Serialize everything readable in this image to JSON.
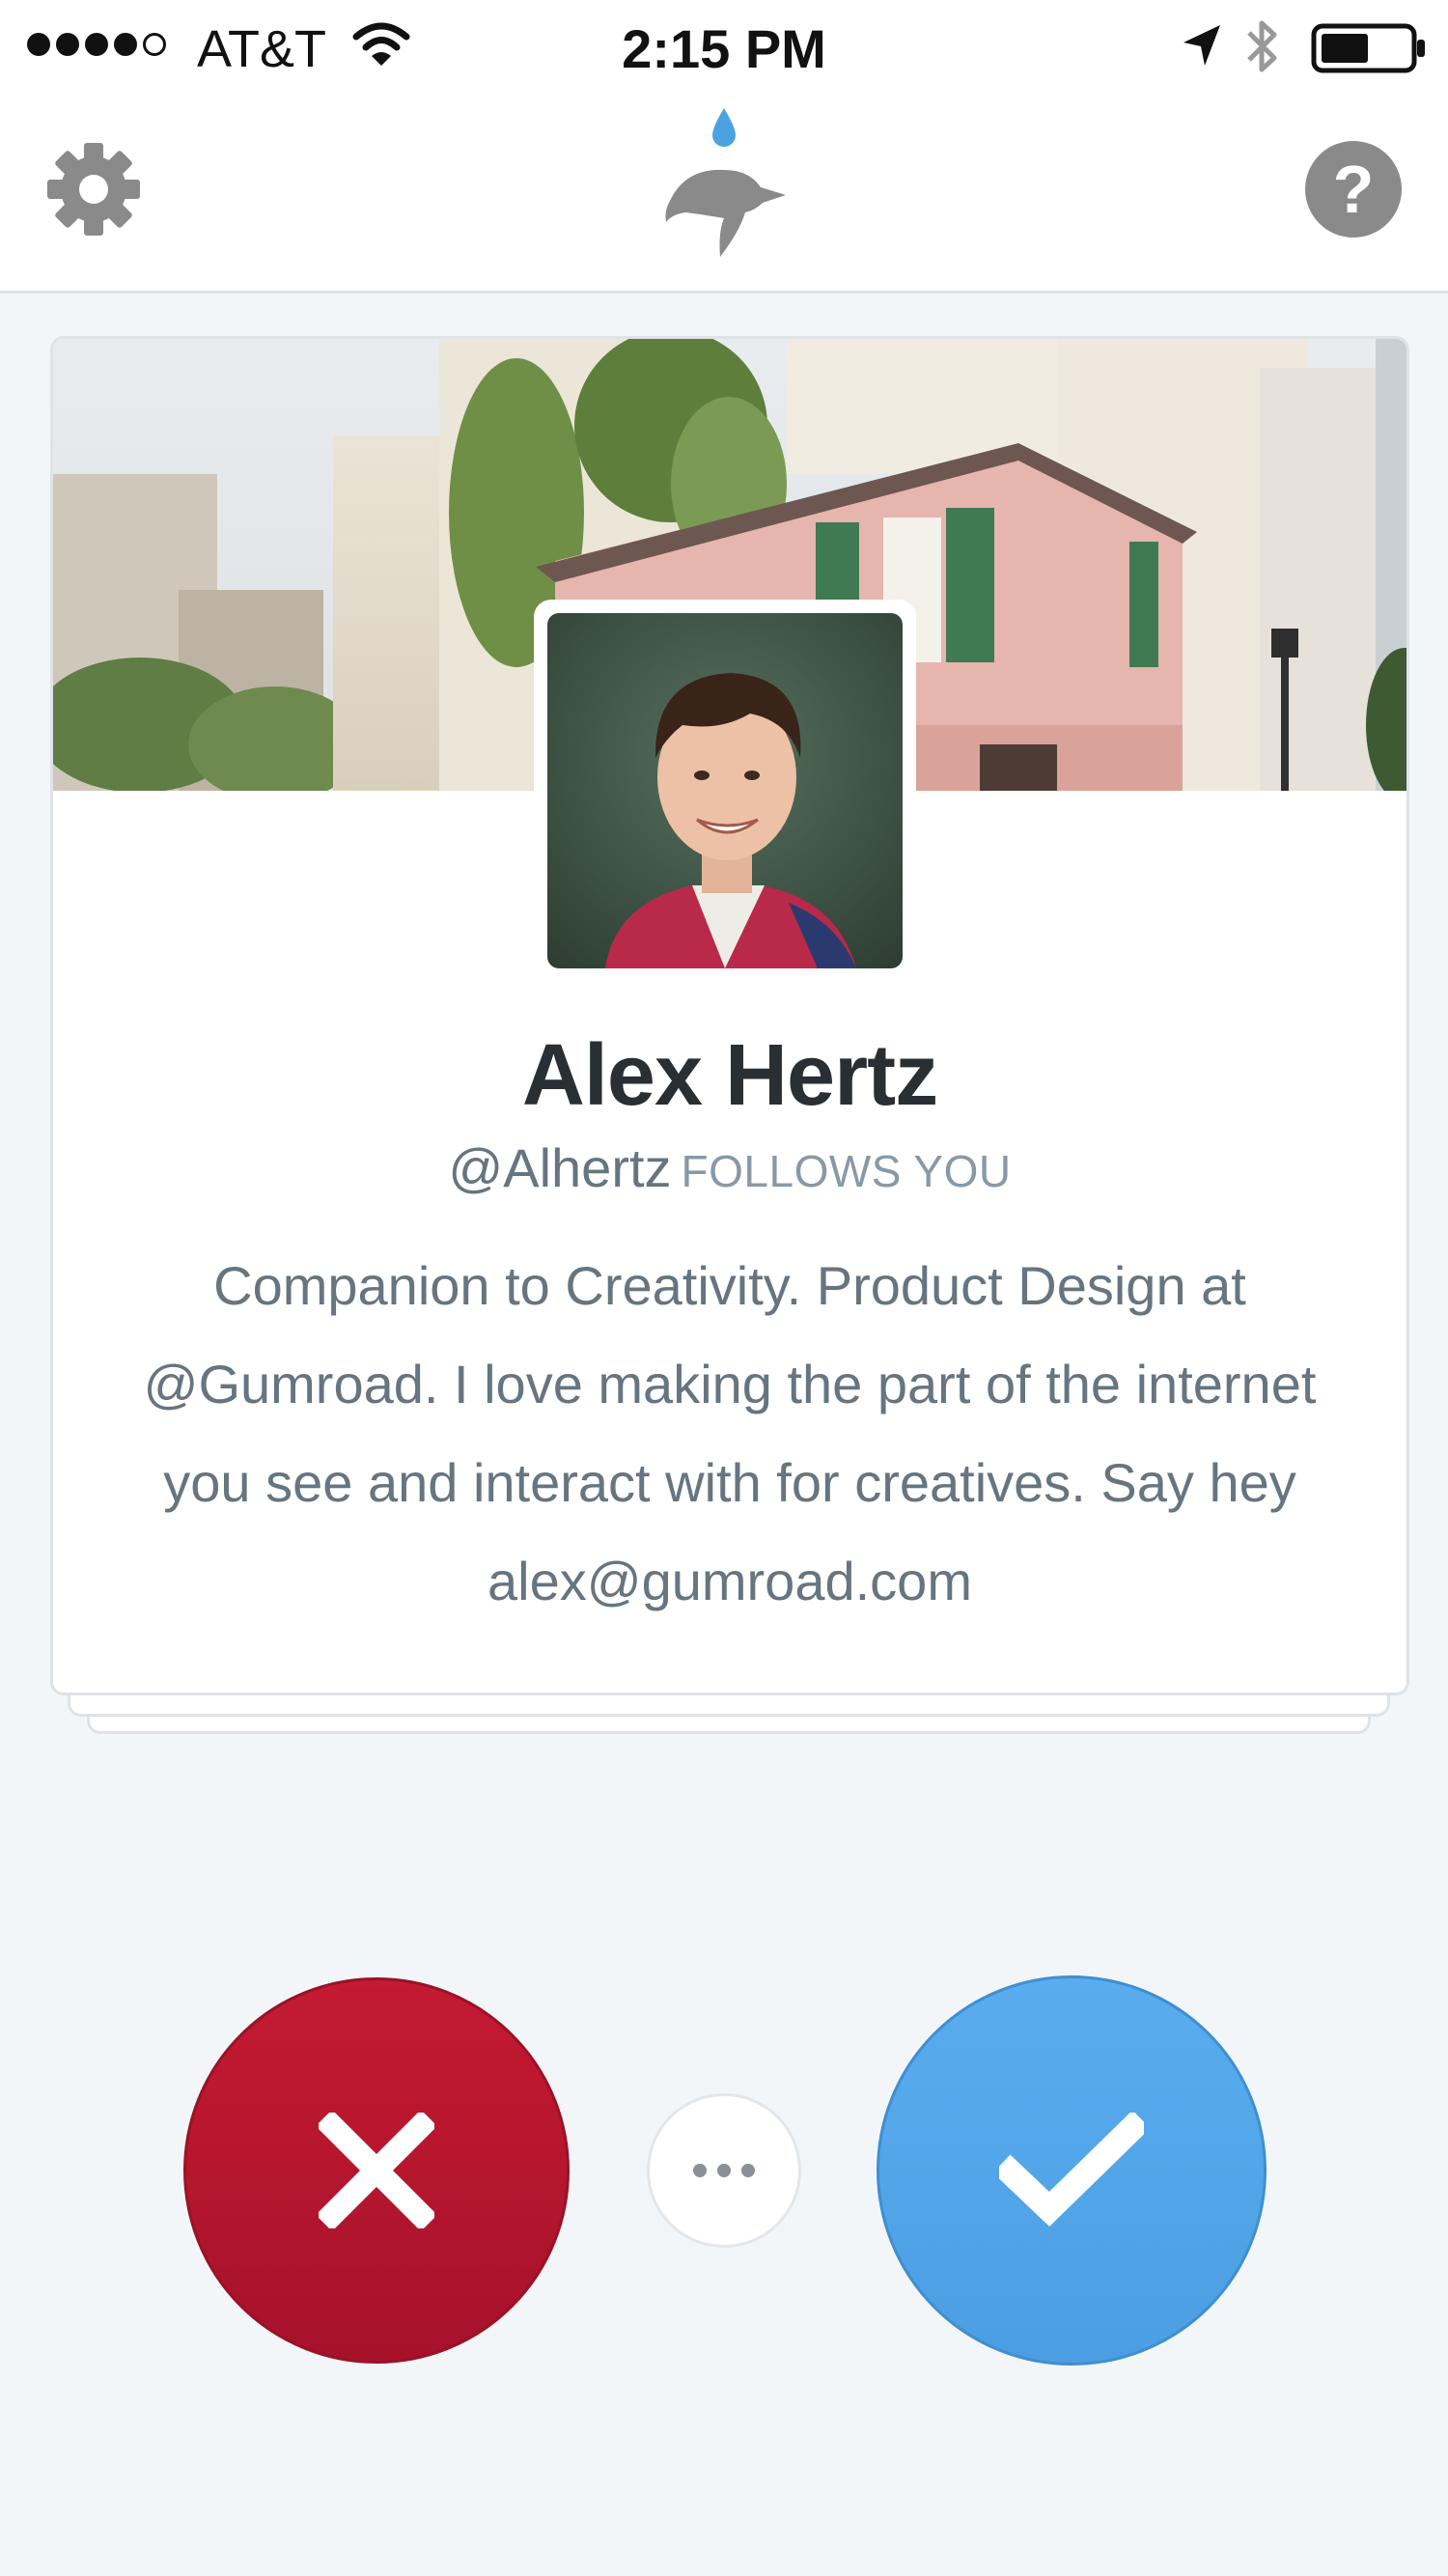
{
  "status_bar": {
    "carrier": "AT&T",
    "time": "2:15 PM",
    "signal_bars_filled": 4,
    "signal_bars_total": 5,
    "battery_level": 0.5,
    "icons": [
      "wifi-icon",
      "location-icon",
      "bluetooth-icon",
      "battery-icon"
    ]
  },
  "nav": {
    "left_icon": "gear-icon",
    "center_icon": "logo-icon",
    "right_icon": "help-icon",
    "accent": "#4aa3df"
  },
  "profile": {
    "name": "Alex Hertz",
    "handle": "@Alhertz",
    "follows_you": "FOLLOWS YOU",
    "bio": "Companion to Creativity. Product Design at @Gumroad. I love making the part of the internet you see and interact with for creatives. Say hey alex@gumroad.com"
  },
  "actions": {
    "reject_icon": "close-icon",
    "more_icon": "more-icon",
    "accept_icon": "checkmark-icon",
    "reject_color": "#b5172e",
    "accept_color": "#53a6e8"
  }
}
